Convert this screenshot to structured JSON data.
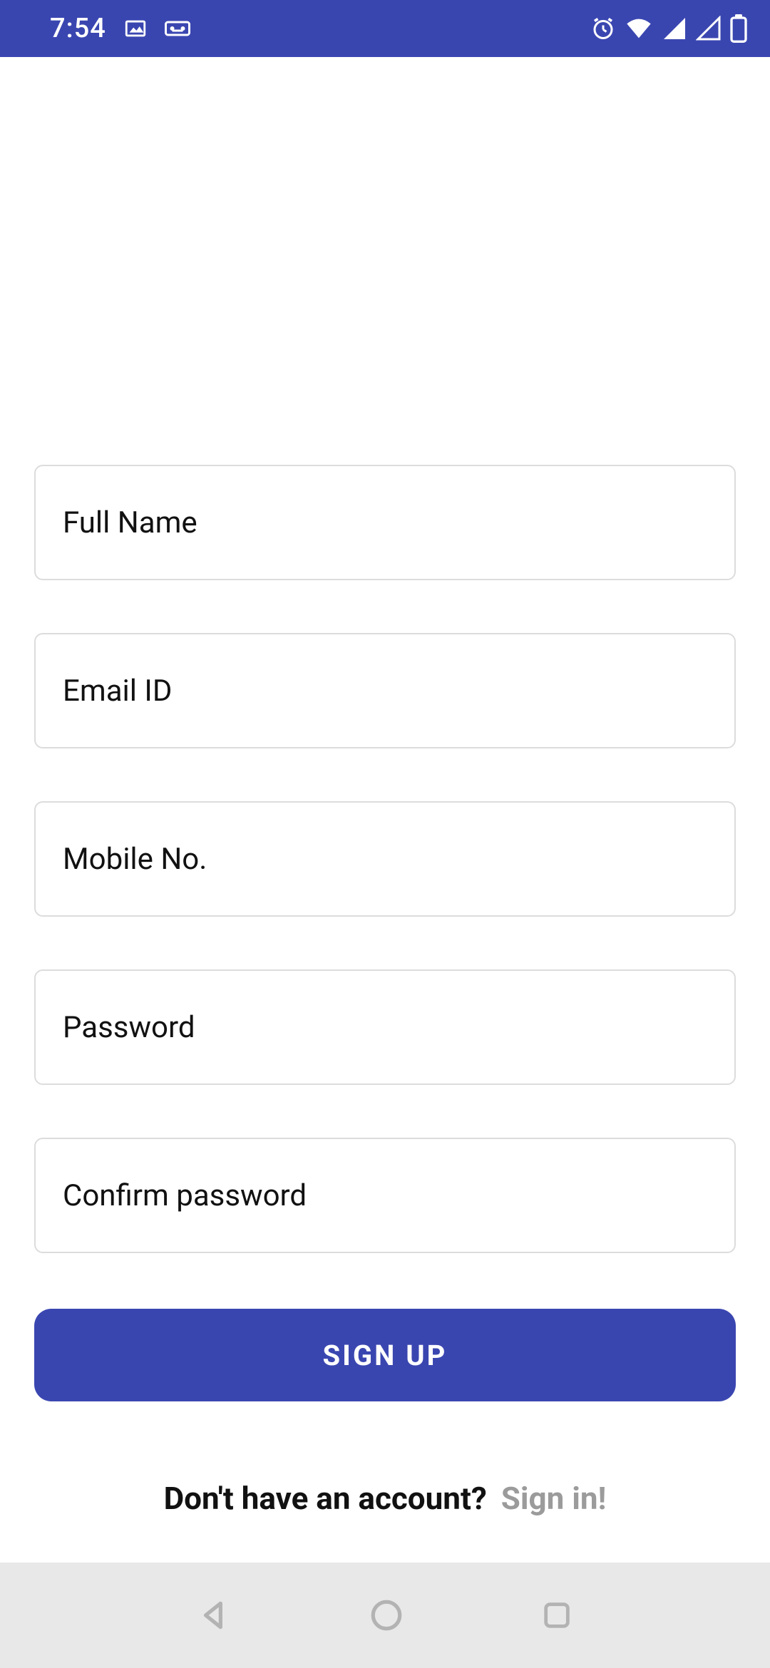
{
  "status_bar": {
    "time": "7:54"
  },
  "form": {
    "fields": {
      "full_name": {
        "placeholder": "Full Name",
        "value": ""
      },
      "email": {
        "placeholder": "Email ID",
        "value": ""
      },
      "mobile": {
        "placeholder": "Mobile No.",
        "value": ""
      },
      "password": {
        "placeholder": "Password",
        "value": ""
      },
      "confirm_password": {
        "placeholder": "Confirm password",
        "value": ""
      }
    },
    "submit_label": "SIGN UP"
  },
  "footer": {
    "prompt": "Don't have an account?",
    "link": "Sign in!"
  },
  "colors": {
    "primary": "#3a46b0",
    "border": "#dcdcdc",
    "muted_text": "#9b9b9b",
    "nav_bg": "#e8e8e8"
  }
}
